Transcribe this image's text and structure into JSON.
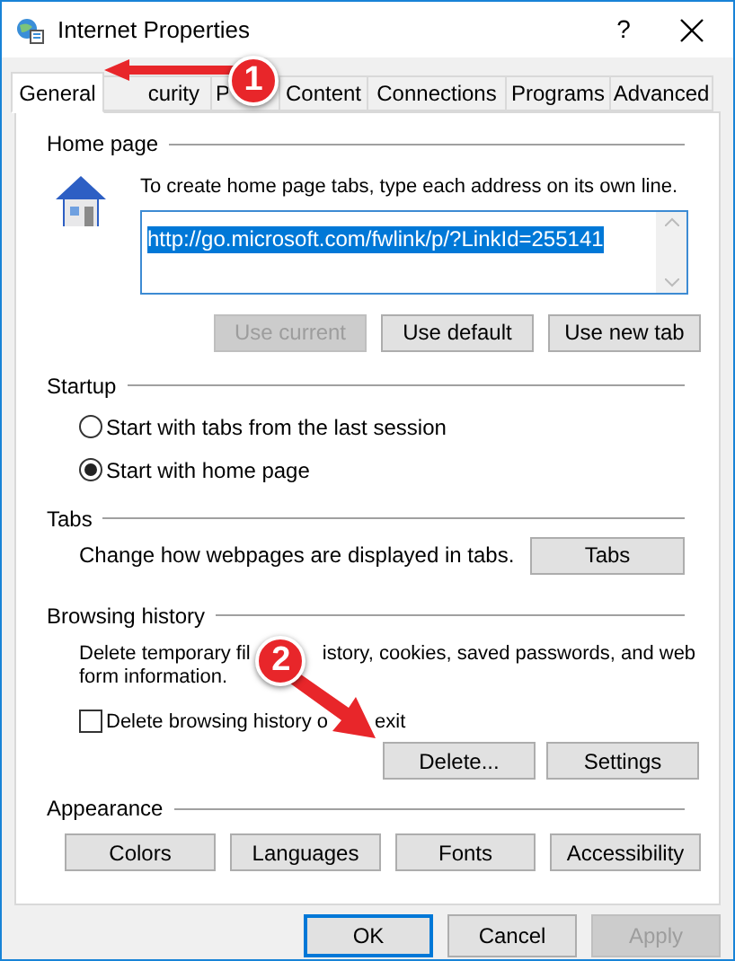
{
  "window": {
    "title": "Internet Properties",
    "help": "?"
  },
  "tabs": [
    {
      "label": "General",
      "selected": true
    },
    {
      "label": "curity",
      "selected": false
    },
    {
      "label": "P",
      "selected": false
    },
    {
      "label": "Content",
      "selected": false
    },
    {
      "label": "Connections",
      "selected": false
    },
    {
      "label": "Programs",
      "selected": false
    },
    {
      "label": "Advanced",
      "selected": false
    }
  ],
  "home_page": {
    "label": "Home page",
    "description": "To create home page tabs, type each address on its own line.",
    "url": "http://go.microsoft.com/fwlink/p/?LinkId=255141",
    "buttons": [
      {
        "label": "Use current",
        "disabled": true
      },
      {
        "label": "Use default",
        "disabled": false
      },
      {
        "label": "Use new tab",
        "disabled": false
      }
    ]
  },
  "startup": {
    "label": "Startup",
    "options": [
      {
        "label": "Start with tabs from the last session",
        "selected": false
      },
      {
        "label": "Start with home page",
        "selected": true
      }
    ]
  },
  "tabs_group": {
    "label": "Tabs",
    "description": "Change how webpages are displayed in tabs.",
    "button": "Tabs"
  },
  "browsing_history": {
    "label": "Browsing history",
    "description_parts": [
      "Delete temporary fil",
      "istory, cookies, saved passwords, and web",
      "form information."
    ],
    "checkbox": {
      "label_parts": [
        "Delete browsing history o",
        "exit"
      ],
      "checked": false
    },
    "buttons": [
      {
        "label": "Delete...",
        "disabled": false
      },
      {
        "label": "Settings",
        "disabled": false
      }
    ]
  },
  "appearance": {
    "label": "Appearance",
    "buttons": [
      {
        "label": "Colors",
        "disabled": false
      },
      {
        "label": "Languages",
        "disabled": false
      },
      {
        "label": "Fonts",
        "disabled": false
      },
      {
        "label": "Accessibility",
        "disabled": false
      }
    ]
  },
  "footer_buttons": [
    {
      "label": "OK",
      "disabled": false,
      "focused": true
    },
    {
      "label": "Cancel",
      "disabled": false,
      "focused": false
    },
    {
      "label": "Apply",
      "disabled": true,
      "focused": false
    }
  ],
  "annotations": [
    {
      "number": "1"
    },
    {
      "number": "2"
    }
  ]
}
